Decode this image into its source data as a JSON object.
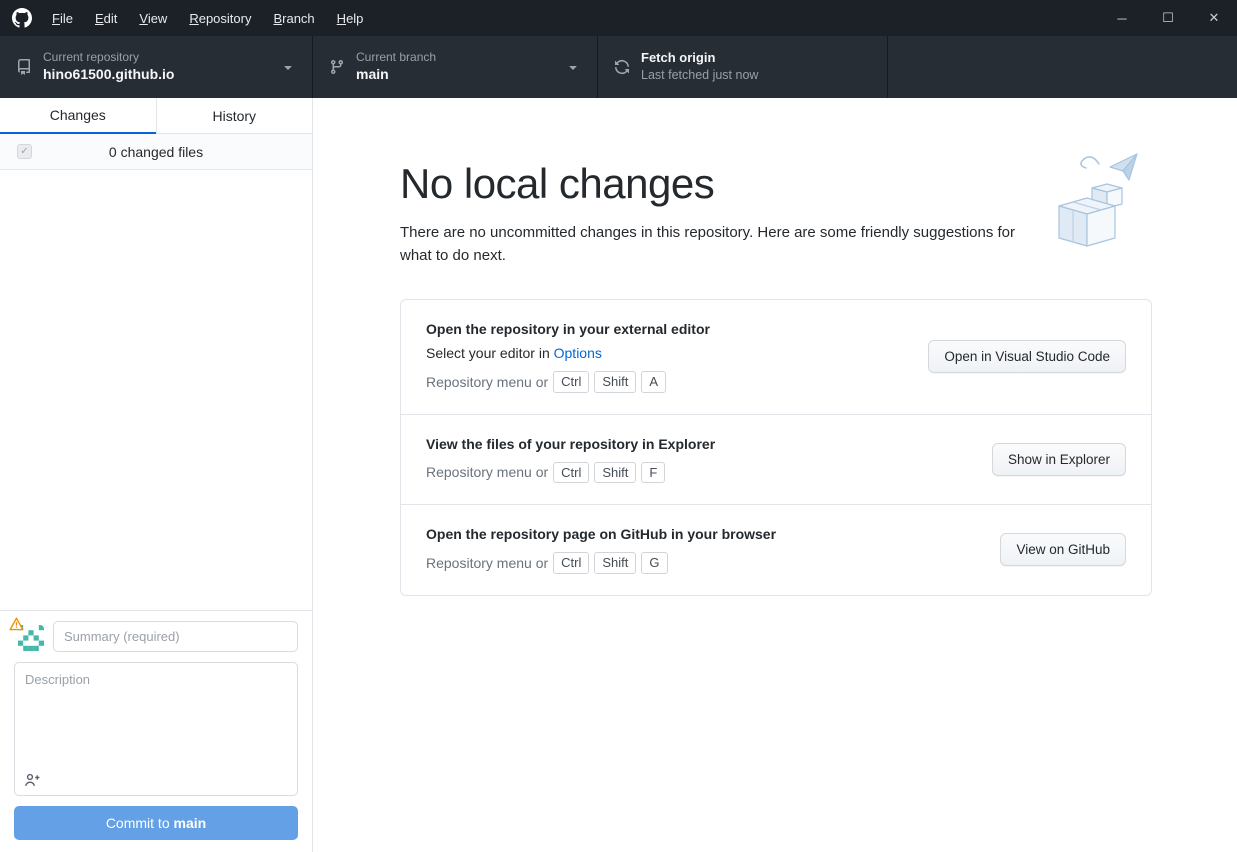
{
  "colors": {
    "accent": "#0366d6",
    "tab_active_underline": "#0366d6",
    "commit_button": "#63a0e6",
    "titlebar_bg": "#1c2127",
    "toolbar_bg": "#272d34",
    "warning_badge": "#e8930c"
  },
  "icons": {
    "app_logo": "github-mark",
    "repository": "repo-book-icon",
    "branch": "git-branch-icon",
    "fetch": "sync-icon",
    "dropdown": "triangle-down-icon",
    "avatar_status": "warning-triangle-icon",
    "co_author": "person-add-icon",
    "illustration": "paper-plane-and-boxes"
  },
  "titlebar": {
    "menu_items": [
      {
        "label": "File"
      },
      {
        "label": "Edit"
      },
      {
        "label": "View"
      },
      {
        "label": "Repository"
      },
      {
        "label": "Branch"
      },
      {
        "label": "Help"
      }
    ],
    "window_controls": {
      "minimize": "─",
      "maximize": "☐",
      "close": "✕"
    }
  },
  "toolbar": {
    "repository": {
      "label": "Current repository",
      "value": "hino61500.github.io"
    },
    "branch": {
      "label": "Current branch",
      "value": "main"
    },
    "fetch": {
      "title": "Fetch origin",
      "subtitle": "Last fetched just now"
    }
  },
  "sidebar": {
    "tabs": [
      {
        "label": "Changes"
      },
      {
        "label": "History"
      }
    ],
    "files_header": {
      "label": "0 changed files"
    },
    "commit_form": {
      "summary_placeholder": "Summary (required)",
      "description_placeholder": "Description",
      "commit_button_prefix": "Commit to ",
      "commit_button_branch": "main"
    }
  },
  "main": {
    "heading": "No local changes",
    "subheading": "There are no uncommitted changes in this repository. Here are some friendly suggestions for what to do next.",
    "suggestions": [
      {
        "title": "Open the repository in your external editor",
        "pre_link": "Select your editor in ",
        "link_label": "Options",
        "shortcut_prefix": "Repository menu or ",
        "keys": [
          "Ctrl",
          "Shift",
          "A"
        ],
        "button_label": "Open in Visual Studio Code"
      },
      {
        "title": "View the files of your repository in Explorer",
        "shortcut_prefix": "Repository menu or ",
        "keys": [
          "Ctrl",
          "Shift",
          "F"
        ],
        "button_label": "Show in Explorer"
      },
      {
        "title": "Open the repository page on GitHub in your browser",
        "shortcut_prefix": "Repository menu or ",
        "keys": [
          "Ctrl",
          "Shift",
          "G"
        ],
        "button_label": "View on GitHub"
      }
    ]
  }
}
